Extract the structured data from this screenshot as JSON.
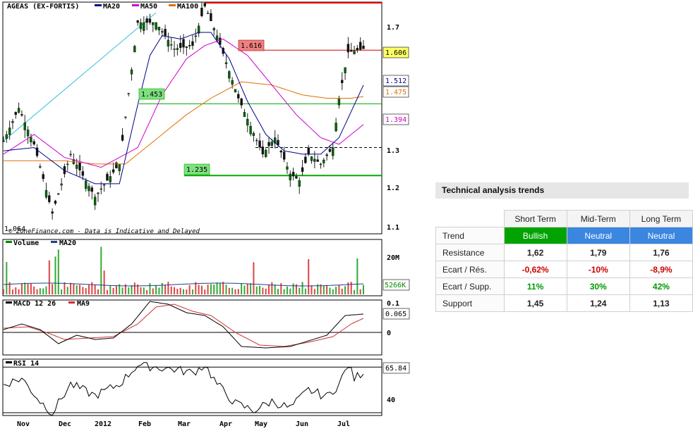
{
  "chart_data": [
    {
      "type": "candlestick",
      "title": "AGEAS (EX-FORTIS)",
      "legend": [
        "MA20",
        "MA50",
        "MA100"
      ],
      "colors": {
        "MA20": "#00008b",
        "MA50": "#cc00cc",
        "MA100": "#e07000",
        "up": "#006600",
        "down": "#111111"
      },
      "x_tick_labels": [
        "Nov",
        "Dec",
        "2012",
        "Feb",
        "Mar",
        "Apr",
        "May",
        "Jun",
        "Jul"
      ],
      "y_tick_labels": [
        "1.7",
        "1.3",
        "1.2",
        "1.1"
      ],
      "ylim": [
        1.06,
        1.76
      ],
      "price_path": [
        [
          0,
          1.34
        ],
        [
          5,
          1.44
        ],
        [
          10,
          1.33
        ],
        [
          16,
          1.12
        ],
        [
          22,
          1.3
        ],
        [
          30,
          1.17
        ],
        [
          38,
          1.27
        ],
        [
          44,
          1.7
        ],
        [
          50,
          1.7
        ],
        [
          56,
          1.62
        ],
        [
          62,
          1.63
        ],
        [
          66,
          1.75
        ],
        [
          70,
          1.66
        ],
        [
          77,
          1.47
        ],
        [
          85,
          1.3
        ],
        [
          89,
          1.35
        ],
        [
          94,
          1.24
        ],
        [
          97,
          1.22
        ],
        [
          100,
          1.3
        ],
        [
          104,
          1.27
        ],
        [
          108,
          1.32
        ],
        [
          110,
          1.47
        ],
        [
          113,
          1.61
        ],
        [
          118,
          1.62
        ]
      ],
      "ma20_path": [
        [
          0,
          1.31
        ],
        [
          10,
          1.32
        ],
        [
          20,
          1.25
        ],
        [
          30,
          1.21
        ],
        [
          38,
          1.21
        ],
        [
          44,
          1.45
        ],
        [
          48,
          1.6
        ],
        [
          52,
          1.66
        ],
        [
          58,
          1.65
        ],
        [
          64,
          1.67
        ],
        [
          68,
          1.67
        ],
        [
          74,
          1.59
        ],
        [
          80,
          1.46
        ],
        [
          86,
          1.36
        ],
        [
          92,
          1.31
        ],
        [
          98,
          1.3
        ],
        [
          104,
          1.3
        ],
        [
          110,
          1.35
        ],
        [
          114,
          1.43
        ],
        [
          118,
          1.51
        ]
      ],
      "ma50_path": [
        [
          0,
          1.3
        ],
        [
          10,
          1.36
        ],
        [
          20,
          1.29
        ],
        [
          32,
          1.26
        ],
        [
          44,
          1.32
        ],
        [
          52,
          1.48
        ],
        [
          60,
          1.59
        ],
        [
          66,
          1.63
        ],
        [
          72,
          1.65
        ],
        [
          80,
          1.6
        ],
        [
          88,
          1.51
        ],
        [
          96,
          1.42
        ],
        [
          104,
          1.35
        ],
        [
          110,
          1.33
        ],
        [
          114,
          1.36
        ],
        [
          118,
          1.39
        ]
      ],
      "ma100_path": [
        [
          0,
          1.28
        ],
        [
          10,
          1.28
        ],
        [
          20,
          1.28
        ],
        [
          30,
          1.27
        ],
        [
          40,
          1.27
        ],
        [
          52,
          1.36
        ],
        [
          60,
          1.42
        ],
        [
          68,
          1.47
        ],
        [
          78,
          1.52
        ],
        [
          88,
          1.51
        ],
        [
          98,
          1.48
        ],
        [
          106,
          1.47
        ],
        [
          114,
          1.47
        ],
        [
          118,
          1.475
        ]
      ],
      "resistance_levels": [
        {
          "label": "1.616",
          "value": 1.616,
          "color": "#cc0000"
        },
        {
          "label": "",
          "value": 1.76,
          "color": "#ee0000"
        }
      ],
      "support_levels": [
        {
          "label": "1.453",
          "value": 1.453,
          "color": "#00aa00"
        },
        {
          "label": "1.235",
          "value": 1.235,
          "color": "#00aa00"
        }
      ],
      "dashed_level": 1.32,
      "last_values": {
        "price": "1.606",
        "ma20": "1.512",
        "ma100": "1.475",
        "ma50": "1.394"
      },
      "low_label": "1.064",
      "annotation": "© ZoneFinance.com - Data is Indicative and Delayed"
    },
    {
      "type": "bar",
      "title": "Volume",
      "legend": [
        "MA20"
      ],
      "y_tick_labels": [
        "20M"
      ],
      "last_value": "5266K"
    },
    {
      "type": "line",
      "title": "MACD 12 26",
      "legend": [
        "MA9"
      ],
      "y_tick_labels": [
        "0.1",
        "0"
      ],
      "last_value": "0.065",
      "macd_path": [
        [
          0,
          0.01
        ],
        [
          6,
          0.03
        ],
        [
          12,
          0.01
        ],
        [
          18,
          -0.04
        ],
        [
          24,
          -0.01
        ],
        [
          30,
          -0.025
        ],
        [
          36,
          -0.02
        ],
        [
          42,
          0.03
        ],
        [
          48,
          0.11
        ],
        [
          54,
          0.1
        ],
        [
          60,
          0.07
        ],
        [
          66,
          0.06
        ],
        [
          72,
          0.02
        ],
        [
          78,
          -0.05
        ],
        [
          86,
          -0.055
        ],
        [
          94,
          -0.05
        ],
        [
          100,
          -0.03
        ],
        [
          106,
          -0.01
        ],
        [
          112,
          0.06
        ],
        [
          118,
          0.065
        ]
      ],
      "signal_path": [
        [
          0,
          0.015
        ],
        [
          8,
          0.02
        ],
        [
          14,
          0.0
        ],
        [
          20,
          -0.025
        ],
        [
          28,
          -0.02
        ],
        [
          36,
          -0.015
        ],
        [
          44,
          0.03
        ],
        [
          50,
          0.09
        ],
        [
          56,
          0.1
        ],
        [
          62,
          0.075
        ],
        [
          68,
          0.06
        ],
        [
          76,
          0.0
        ],
        [
          84,
          -0.045
        ],
        [
          92,
          -0.05
        ],
        [
          100,
          -0.035
        ],
        [
          108,
          -0.015
        ],
        [
          114,
          0.03
        ],
        [
          118,
          0.05
        ]
      ]
    },
    {
      "type": "line",
      "title": "RSI 14",
      "y_tick_labels": [
        "40"
      ],
      "last_value": "65.84",
      "rsi_path": [
        [
          0,
          55
        ],
        [
          6,
          60
        ],
        [
          12,
          40
        ],
        [
          16,
          30
        ],
        [
          22,
          55
        ],
        [
          30,
          45
        ],
        [
          38,
          55
        ],
        [
          44,
          72
        ],
        [
          50,
          70
        ],
        [
          56,
          68
        ],
        [
          62,
          65
        ],
        [
          66,
          72
        ],
        [
          70,
          55
        ],
        [
          76,
          38
        ],
        [
          82,
          32
        ],
        [
          88,
          40
        ],
        [
          94,
          34
        ],
        [
          100,
          50
        ],
        [
          106,
          44
        ],
        [
          110,
          55
        ],
        [
          113,
          72
        ],
        [
          115,
          60
        ],
        [
          118,
          66
        ]
      ]
    }
  ],
  "technical_analysis": {
    "title": "Technical analysis trends",
    "columns": [
      "Short Term",
      "Mid-Term",
      "Long Term"
    ],
    "rows": [
      {
        "label": "Trend",
        "values": [
          "Bullish",
          "Neutral",
          "Neutral"
        ]
      },
      {
        "label": "Resistance",
        "values": [
          "1,62",
          "1,79",
          "1,76"
        ]
      },
      {
        "label": "Ecart / Rés.",
        "values": [
          "-0,62%",
          "-10%",
          "-8,9%"
        ]
      },
      {
        "label": "Ecart / Supp.",
        "values": [
          "11%",
          "30%",
          "42%"
        ]
      },
      {
        "label": "Support",
        "values": [
          "1,45",
          "1,24",
          "1,13"
        ]
      }
    ]
  }
}
